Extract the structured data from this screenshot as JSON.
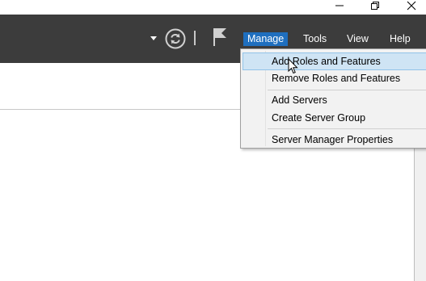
{
  "window_controls": {
    "minimize_icon": "minimize-icon",
    "restore_icon": "restore-icon",
    "close_icon": "close-icon"
  },
  "toolbar": {
    "dropdown_arrow_icon": "caret-down-icon",
    "refresh_icon": "refresh-icon",
    "notifications_icon": "flag-icon"
  },
  "menu": {
    "manage": "Manage",
    "tools": "Tools",
    "view": "View",
    "help": "Help"
  },
  "manage_menu": {
    "items": [
      {
        "label": "Add Roles and Features",
        "highlighted": true
      },
      {
        "label": "Remove Roles and Features"
      },
      {
        "label": "Add Servers"
      },
      {
        "label": "Create Server Group"
      },
      {
        "label": "Server Manager Properties"
      }
    ]
  },
  "colors": {
    "toolbar_bg": "#3c3c3c",
    "active_menu_bg": "#1f6fbf",
    "menu_highlight_bg": "#cfe4f4",
    "menu_highlight_border": "#92c3e8"
  }
}
